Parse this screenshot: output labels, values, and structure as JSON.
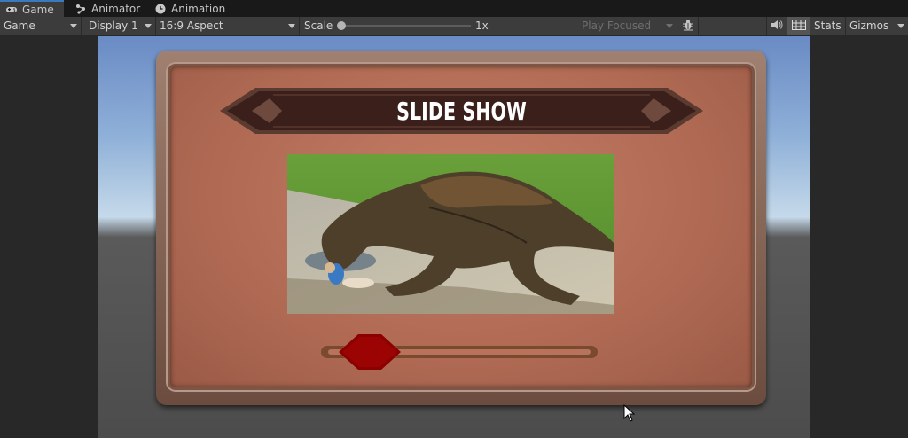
{
  "tabs": [
    {
      "label": "Game",
      "icon": "gamepad-icon",
      "active": true
    },
    {
      "label": "Animator",
      "icon": "animator-icon",
      "active": false
    },
    {
      "label": "Animation",
      "icon": "clock-icon",
      "active": false
    }
  ],
  "toolbar": {
    "view_dropdown": "Game",
    "display_dropdown": "Display 1",
    "aspect_dropdown": "16:9 Aspect",
    "scale_label": "Scale",
    "scale_value": "1x",
    "scale_fraction": 0.0,
    "play_mode_dropdown": "Play Focused",
    "stats_label": "Stats",
    "gizmos_label": "Gizmos",
    "icons": [
      "bug-icon",
      "speaker-icon",
      "stats-grid-icon"
    ]
  },
  "game": {
    "title": "SLIDE SHOW",
    "slide_image": "dinosaur-scene",
    "slider_position": 0.17,
    "colors": {
      "panel": "#b06a54",
      "handle": "#8b0000",
      "banner": "#3a1f1a"
    }
  }
}
